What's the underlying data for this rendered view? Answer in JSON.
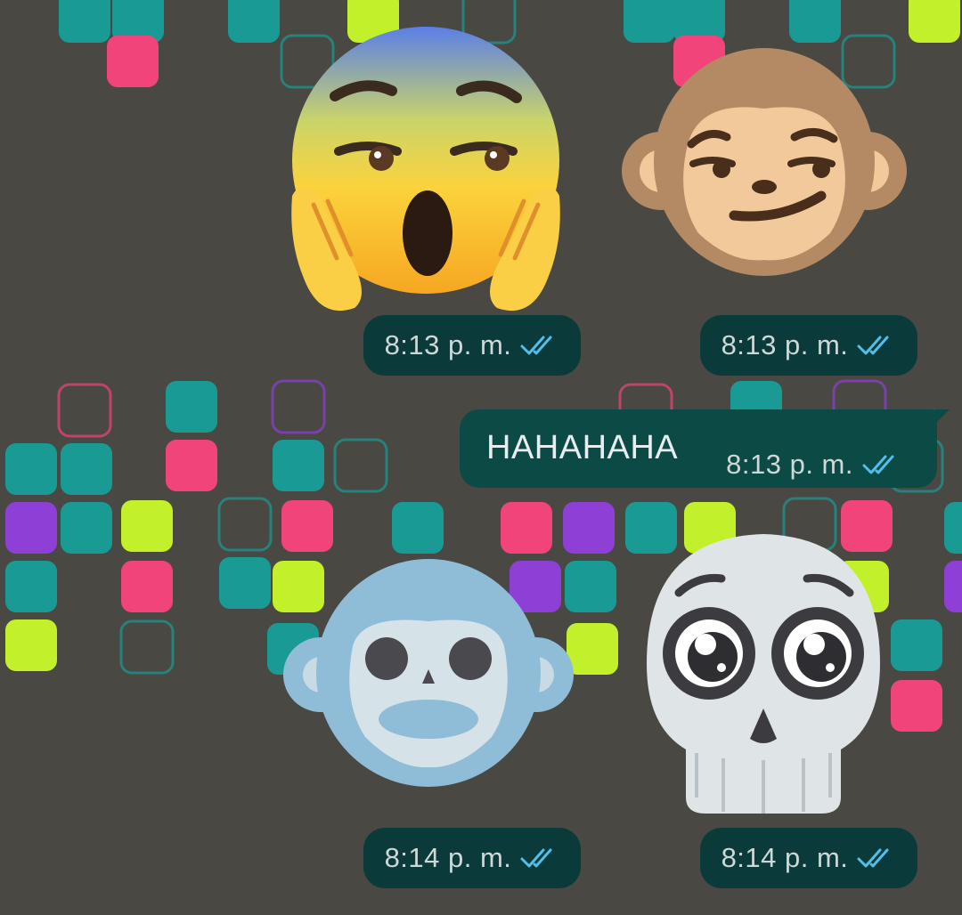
{
  "wallpaper": {
    "base_color": "#494842",
    "tile_colors": [
      "#1a9a95",
      "#f0447a",
      "#c2f02a",
      "#8e3fd6"
    ]
  },
  "messages": [
    {
      "kind": "sticker",
      "sticker": "shocked-face-with-hands-icon",
      "time": "8:13 p. m.",
      "status": "read-double-check-icon"
    },
    {
      "kind": "sticker",
      "sticker": "smirking-monkey-icon",
      "time": "8:13 p. m.",
      "status": "read-double-check-icon"
    },
    {
      "kind": "text",
      "text": "HAHAHAHA",
      "time": "8:13 p. m.",
      "status": "read-double-check-icon"
    },
    {
      "kind": "sticker",
      "sticker": "skull-monkey-icon",
      "time": "8:14 p. m.",
      "status": "read-double-check-icon"
    },
    {
      "kind": "sticker",
      "sticker": "pleading-skull-icon",
      "time": "8:14 p. m.",
      "status": "read-double-check-icon"
    }
  ],
  "colors": {
    "pill_bg": "#0a3b3a",
    "bubble_bg": "#0b4a45",
    "tick_blue": "#53bdeb",
    "meta_text": "#cfd8d6",
    "msg_text": "#e9edef"
  }
}
